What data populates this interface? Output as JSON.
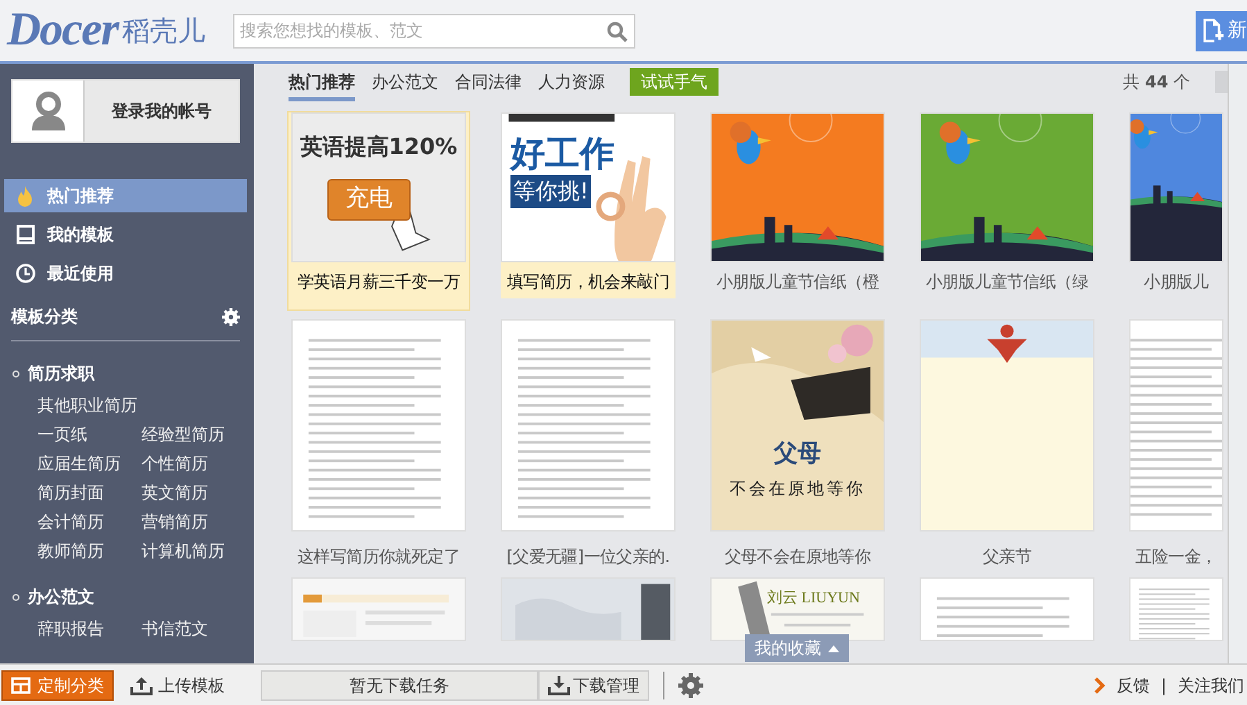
{
  "header": {
    "logo": "Docer",
    "logo_cn": "稻壳儿",
    "search": {
      "placeholder": "搜索您想找的模板、范文"
    },
    "new_button": "新"
  },
  "account": {
    "login": "登录我的帐号"
  },
  "nav": [
    {
      "label": "热门推荐",
      "selected": true
    },
    {
      "label": "我的模板",
      "selected": false
    },
    {
      "label": "最近使用",
      "selected": false
    }
  ],
  "category_title": "模板分类",
  "categories": [
    {
      "title": "简历求职",
      "rows": [
        [
          "其他职业简历"
        ],
        [
          "一页纸",
          "经验型简历"
        ],
        [
          "应届生简历",
          "个性简历"
        ],
        [
          "简历封面",
          "英文简历"
        ],
        [
          "会计简历",
          "营销简历"
        ],
        [
          "教师简历",
          "计算机简历"
        ]
      ]
    },
    {
      "title": "办公范文",
      "rows": [
        [
          "辞职报告",
          "书信范文"
        ]
      ]
    }
  ],
  "tabs": [
    {
      "label": "热门推荐",
      "selected": true
    },
    {
      "label": "办公范文",
      "selected": false
    },
    {
      "label": "合同法律",
      "selected": false
    },
    {
      "label": "人力资源",
      "selected": false
    }
  ],
  "lucky_button": "试试手气",
  "count": "共 **44** 个",
  "card_rows": [
    {
      "cards": [
        {
          "caption": "学英语月薪三千变一万",
          "selected": true,
          "highlighted": true,
          "overlay": [
            {
              "text": "英语提高120%",
              "kind": "headline"
            },
            {
              "text": "充电",
              "kind": "button"
            }
          ]
        },
        {
          "caption": "填写简历，机会来敲门",
          "selected": false,
          "highlighted": true,
          "overlay": [
            {
              "text": "好工作",
              "kind": "big"
            },
            {
              "text": "等你挑!",
              "kind": "tag"
            }
          ]
        },
        {
          "caption": "小朋版儿童节信纸（橙",
          "selected": false,
          "highlighted": false
        },
        {
          "caption": "小朋版儿童节信纸（绿",
          "selected": false,
          "highlighted": false
        },
        {
          "caption": "小朋版儿",
          "selected": false,
          "highlighted": false
        }
      ]
    },
    {
      "cards": [
        {
          "caption": "这样写简历你就死定了",
          "selected": false,
          "highlighted": false
        },
        {
          "caption": "[父爱无疆]一位父亲的.",
          "selected": false,
          "highlighted": false
        },
        {
          "caption": "父母不会在原地等你",
          "selected": false,
          "highlighted": false,
          "overlay": [
            {
              "text": "父母",
              "kind": "title"
            },
            {
              "text": "不会在原地等你",
              "kind": "sub"
            }
          ]
        },
        {
          "caption": "父亲节",
          "selected": false,
          "highlighted": false
        },
        {
          "caption": "五险一金，",
          "selected": false,
          "highlighted": false
        }
      ]
    }
  ],
  "last_row": {
    "name_card_text": "刘云 LIUYUN"
  },
  "favorites": "我的收藏",
  "bottom": {
    "customize": "定制分类",
    "upload": "上传模板",
    "download_status": "暂无下载任务",
    "download_manager": "下载管理",
    "feedback": "反馈",
    "separator": "|",
    "follow": "关注我们"
  }
}
